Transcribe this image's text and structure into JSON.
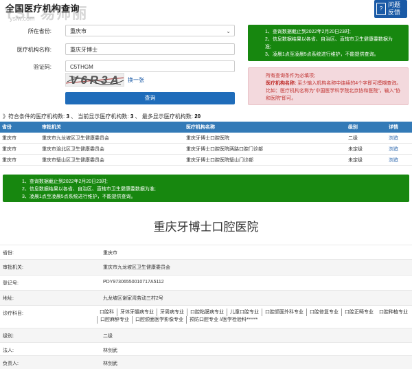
{
  "header": {
    "title": "全国医疗机构查询",
    "watermark": "YSL 易师丽",
    "watermark_url": "yslw.com",
    "feedback": {
      "line1": "问题",
      "line2": "反馈"
    }
  },
  "form": {
    "province_label": "所在省份:",
    "province_value": "重庆市",
    "name_label": "医疗机构名称:",
    "name_value": "重庆牙博士",
    "code_label": "验证码:",
    "code_value": "C5THGM",
    "captcha_text": "V6R3A",
    "refresh_label": "换一张",
    "query_button": "查询"
  },
  "notice": {
    "items": [
      "1、查询数据截止到2022年2月20日23时;",
      "2、信息数据结果以各省、自治区、直辖市卫生健康委数据为准;",
      "3、凌晨1点至凌晨5点系统进行维护，不能提供查询。"
    ],
    "short_items": [
      "1、查询数据截止到2022年2月20日23时;",
      "2、信息数据结果以各省、自治区、直辖市卫生健康委数据为",
      "准;",
      "3、凌晨1点至凌晨5点系统进行维护，不能提供查询。"
    ]
  },
  "tips": {
    "heading": "所有查询条件为必填项;",
    "body_label": "医疗机构名称:",
    "body": "至少输入机构名称中连续的4个字即可模糊查询。比如：医疗机构名称为“中国医学科学院北京协和医院”，输入“协和医院”即可。"
  },
  "results": {
    "label_a": "》符合条件的医疗机构数:",
    "count_a": "3",
    "label_b": "、 当前显示医疗机构数:",
    "count_b": "3",
    "label_c": "、 最多显示医疗机构数:",
    "count_c": "20",
    "columns": [
      "省份",
      "审批机关",
      "医疗机构名称",
      "级别",
      "详情"
    ],
    "rows": [
      [
        "重庆市",
        "重庆市九龙坡区卫生健康委员会",
        "重庆牙博士口腔医院",
        "二级",
        "浏览"
      ],
      [
        "重庆市",
        "重庆市渝北区卫生健康委员会",
        "重庆牙博士口腔医院两路口腔门诊部",
        "未定级",
        "浏览"
      ],
      [
        "重庆市",
        "重庆市璧山区卫生健康委员会",
        "重庆牙博士口腔医院璧山门诊部",
        "未定级",
        "浏览"
      ]
    ]
  },
  "detail": {
    "title": "重庆牙博士口腔医院",
    "province_k": "省份:",
    "province_v": "重庆市",
    "authority_k": "审批机关:",
    "authority_v": "重庆市九龙坡区卫生健康委员会",
    "reg_k": "登记号:",
    "reg_v": "PDY97306550010717A5112",
    "addr_k": "地址:",
    "addr_v": "九龙坡区谢家湾劳动三村2号",
    "subjects_k": "诊疗科目:",
    "subjects": [
      "口腔科",
      "牙体牙髓病专业",
      "牙周病专业",
      "口腔粘膜病专业",
      "儿童口腔专业",
      "口腔颌面外科专业",
      "口腔修复专业",
      "口腔正畸专业",
      "口腔种植专业",
      "口腔麻醉专业",
      "口腔颌面医学影像专业",
      "预防口腔专业 //医学检验科******"
    ],
    "level_k": "级别:",
    "level_v": "二级",
    "legal_k": "法人:",
    "legal_v": "林剑武",
    "head_k": "负责人:",
    "head_v": "林剑武"
  }
}
